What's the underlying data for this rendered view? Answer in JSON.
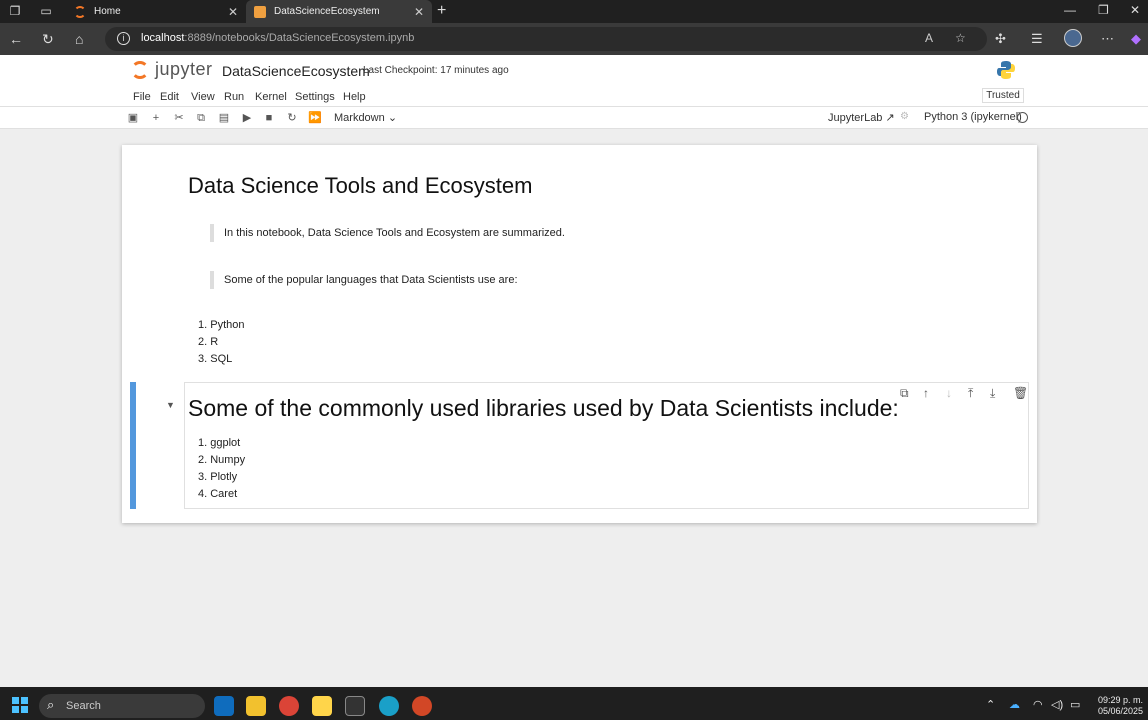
{
  "browser": {
    "tabs": [
      {
        "label": "Home"
      },
      {
        "label": "DataScienceEcosystem"
      }
    ],
    "url_host": "localhost",
    "url_path": ":8889/notebooks/DataScienceEcosystem.ipynb"
  },
  "jupyter": {
    "logo_text": "jupyter",
    "notebook_title": "DataScienceEcosystem",
    "checkpoint": "Last Checkpoint: 17 minutes ago",
    "menu": [
      "File",
      "Edit",
      "View",
      "Run",
      "Kernel",
      "Settings",
      "Help"
    ],
    "trusted": "Trusted",
    "cell_type": "Markdown",
    "jupyterlab_link": "JupyterLab",
    "kernel": "Python 3 (ipykernel)"
  },
  "notebook": {
    "title": "Data Science Tools and Ecosystem",
    "intro_quote": "In this notebook, Data Science Tools and Ecosystem are summarized.",
    "languages_quote": "Some of the popular languages that Data Scientists use are:",
    "languages": [
      "1. Python",
      "2. R",
      "3. SQL"
    ],
    "libraries_heading": "Some of the commonly used libraries used by Data Scientists include:",
    "libraries": [
      "1. ggplot",
      "2. Numpy",
      "3. Plotly",
      "4. Caret"
    ]
  },
  "taskbar": {
    "search_label": "Search",
    "time": "09:29 p. m.",
    "date": "05/06/2025"
  },
  "colors": {
    "jupyter_orange": "#f37726",
    "active_cell": "#1976d2"
  }
}
